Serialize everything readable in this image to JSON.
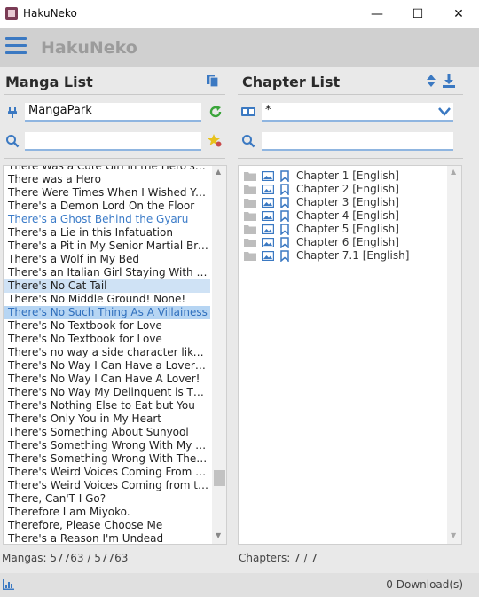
{
  "window": {
    "title": "HakuNeko",
    "minimize": "—",
    "maximize": "☐",
    "close": "✕"
  },
  "app": {
    "title": "HakuNeko"
  },
  "manga_panel": {
    "title": "Manga List",
    "connector": "MangaPark",
    "search_value": "",
    "status": "Mangas: 57763 / 57763",
    "items": [
      {
        "label": "There Was a Cute Girl in the Hero's Party",
        "state": "normal"
      },
      {
        "label": "There was a Hero",
        "state": "normal"
      },
      {
        "label": "There Were Times When I Wished You Were Gone",
        "state": "normal"
      },
      {
        "label": "There's a Demon Lord On the Floor",
        "state": "normal"
      },
      {
        "label": "There's a Ghost Behind the Gyaru",
        "state": "blue"
      },
      {
        "label": "There's a Lie in this Infatuation",
        "state": "normal"
      },
      {
        "label": "There's a Pit in My Senior Martial Brother's Head",
        "state": "normal"
      },
      {
        "label": "There's a Wolf in My Bed",
        "state": "normal"
      },
      {
        "label": "There's an Italian Girl Staying With Me",
        "state": "normal"
      },
      {
        "label": "There's No Cat Tail",
        "state": "selected"
      },
      {
        "label": "There's No Middle Ground! None!",
        "state": "normal"
      },
      {
        "label": "There's No Such Thing As A Villainess",
        "state": "selected-blue"
      },
      {
        "label": "There's No Textbook for Love",
        "state": "normal"
      },
      {
        "label": "There's No Textbook for Love",
        "state": "normal"
      },
      {
        "label": "There's no way a side character like me could be popular",
        "state": "normal"
      },
      {
        "label": "There's No Way I Can Have a Lover! *Or Maybe",
        "state": "normal"
      },
      {
        "label": "There's No Way I Can Have A Lover!",
        "state": "normal"
      },
      {
        "label": "There's No Way My Delinquent is This Cute",
        "state": "normal"
      },
      {
        "label": "There's Nothing Else to Eat but You",
        "state": "normal"
      },
      {
        "label": "There's Only You in My Heart",
        "state": "normal"
      },
      {
        "label": "There's Something About Sunyool",
        "state": "normal"
      },
      {
        "label": "There's Something Wrong With My Wife",
        "state": "normal"
      },
      {
        "label": "There's Something Wrong With The Vampire",
        "state": "normal"
      },
      {
        "label": "There's Weird Voices Coming From the Dungeon",
        "state": "normal"
      },
      {
        "label": "There's Weird Voices Coming from the Closet",
        "state": "normal"
      },
      {
        "label": "There, Can'T I Go?",
        "state": "normal"
      },
      {
        "label": "Therefore I am Miyoko.",
        "state": "normal"
      },
      {
        "label": "Therefore, Please Choose Me",
        "state": "normal"
      },
      {
        "label": "There's a Reason I'm Undead",
        "state": "normal"
      }
    ]
  },
  "chapter_panel": {
    "title": "Chapter List",
    "language_filter": "*",
    "search_value": "",
    "status": "Chapters: 7 / 7",
    "items": [
      "Chapter 1 [English]",
      "Chapter 2 [English]",
      "Chapter 3 [English]",
      "Chapter 4 [English]",
      "Chapter 5 [English]",
      "Chapter 6 [English]",
      "Chapter 7.1 [English]"
    ]
  },
  "footer": {
    "downloads": "0 Download(s)"
  },
  "colors": {
    "accent": "#3b79c2",
    "green": "#3aa53a",
    "folder": "#bdbdbd"
  }
}
